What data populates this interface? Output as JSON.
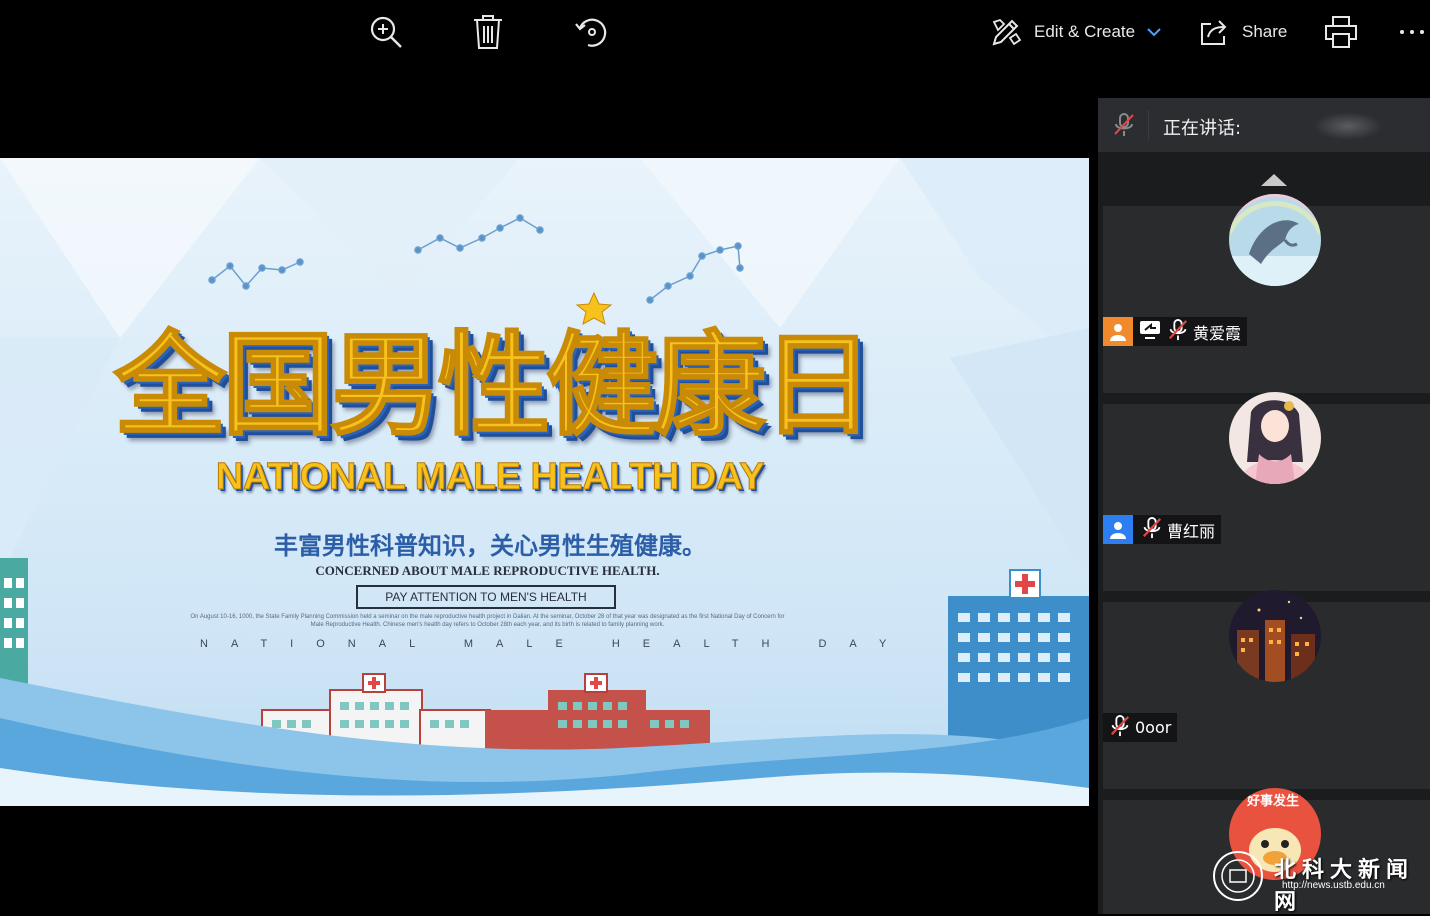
{
  "toolbar": {
    "edit_create_label": "Edit & Create",
    "share_label": "Share"
  },
  "slide": {
    "main_title": "全国男性健康日",
    "english_title": "NATIONAL MALE HEALTH DAY",
    "chinese_subtitle": "丰富男性科普知识，关心男性生殖健康。",
    "english_subtitle": "CONCERNED ABOUT MALE REPRODUCTIVE HEALTH.",
    "attention_box": "PAY ATTENTION TO MEN'S HEALTH",
    "fine_print": "On August 10-16, 1000, the State Family Planning Commission held a seminar on the male reproductive health project in Dalian. At the seminar, October 28 of that year was designated as the first National Day of Concern for Male Reproductive Health. Chinese men's health day refers to October 28th each year, and its birth is related to family planning work.",
    "spaced_caption": "NATIONAL MALE HEALTH DAY"
  },
  "panel": {
    "speaking_label": "正在讲话:",
    "participants": [
      {
        "name": "黄爱霞",
        "badge": "orange",
        "avatar": "dolphin-avatar"
      },
      {
        "name": "曹红丽",
        "badge": "blue",
        "avatar": "anime-girl-avatar"
      },
      {
        "name": "0oor",
        "badge": "",
        "avatar": "night-city-avatar"
      },
      {
        "name": "",
        "badge": "",
        "avatar": "duck-avatar"
      }
    ],
    "avatar4_caption": "好事发生"
  },
  "watermark": {
    "text": "北科大新闻网",
    "url": "http://news.ustb.edu.cn"
  },
  "colors": {
    "orange_badge": "#f08a2c",
    "blue_badge": "#2d7ef0",
    "title_gold": "#f7c21d",
    "muted_red": "#e04848"
  }
}
